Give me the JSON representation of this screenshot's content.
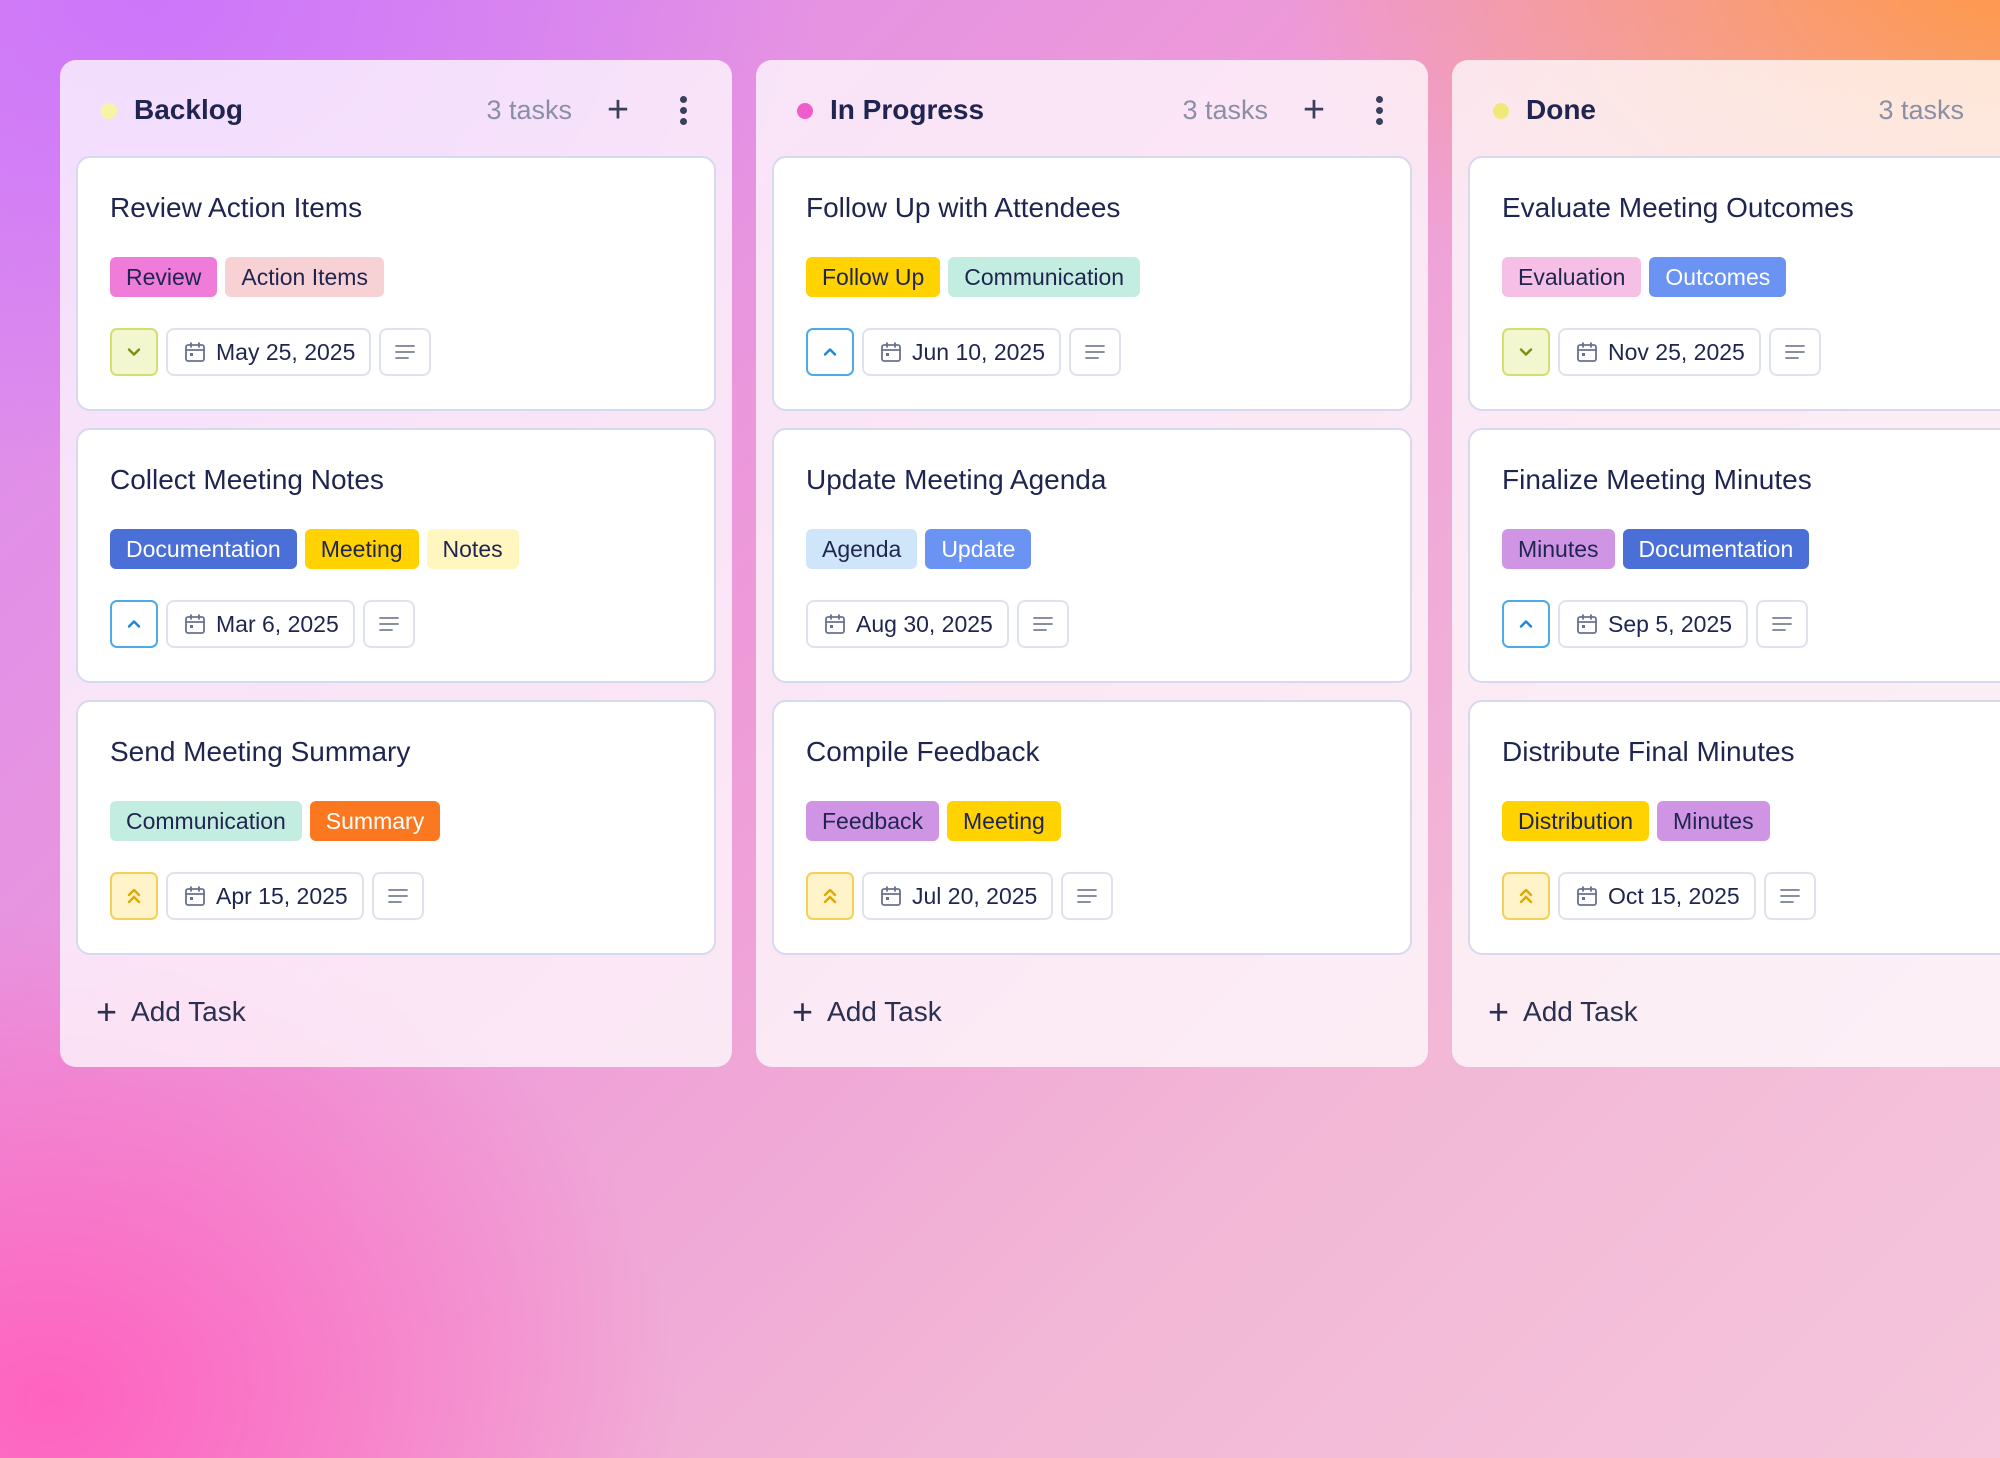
{
  "columns": [
    {
      "title": "Backlog",
      "count": "3 tasks",
      "dot_color": "#f9f3a4",
      "add_task_label": "Add Task",
      "cards": [
        {
          "title": "Review Action Items",
          "tags": [
            {
              "label": "Review",
              "bg": "#f07cd9",
              "fg": "#1f2550"
            },
            {
              "label": "Action Items",
              "bg": "#f7d1d4",
              "fg": "#1f2550"
            }
          ],
          "priority": "low",
          "priority_icon": "chevron-down-icon",
          "date": "May 25, 2025"
        },
        {
          "title": "Collect Meeting Notes",
          "tags": [
            {
              "label": "Documentation",
              "bg": "#4a6fd6",
              "fg": "#ffffff"
            },
            {
              "label": "Meeting",
              "bg": "#ffd200",
              "fg": "#1f2550"
            },
            {
              "label": "Notes",
              "bg": "#fff6c0",
              "fg": "#1f2550"
            }
          ],
          "priority": "medium",
          "priority_icon": "chevron-up-icon",
          "date": "Mar 6, 2025"
        },
        {
          "title": "Send Meeting Summary",
          "tags": [
            {
              "label": "Communication",
              "bg": "#c3ede0",
              "fg": "#1f2550"
            },
            {
              "label": "Summary",
              "bg": "#fb7820",
              "fg": "#ffffff"
            }
          ],
          "priority": "high",
          "priority_icon": "double-chevron-up-icon",
          "date": "Apr 15, 2025"
        }
      ]
    },
    {
      "title": "In Progress",
      "count": "3 tasks",
      "dot_color": "#f05ccb",
      "add_task_label": "Add Task",
      "cards": [
        {
          "title": "Follow Up with Attendees",
          "tags": [
            {
              "label": "Follow Up",
              "bg": "#ffd200",
              "fg": "#1f2550"
            },
            {
              "label": "Communication",
              "bg": "#c3ede0",
              "fg": "#1f2550"
            }
          ],
          "priority": "medium",
          "priority_icon": "chevron-up-icon",
          "date": "Jun 10, 2025"
        },
        {
          "title": "Update Meeting Agenda",
          "tags": [
            {
              "label": "Agenda",
              "bg": "#cfe6fa",
              "fg": "#1f2550"
            },
            {
              "label": "Update",
              "bg": "#6b93f3",
              "fg": "#ffffff"
            }
          ],
          "priority": "none",
          "priority_icon": "",
          "date": "Aug 30, 2025"
        },
        {
          "title": "Compile Feedback",
          "tags": [
            {
              "label": "Feedback",
              "bg": "#cf95e4",
              "fg": "#1f2550"
            },
            {
              "label": "Meeting",
              "bg": "#ffd200",
              "fg": "#1f2550"
            }
          ],
          "priority": "high",
          "priority_icon": "double-chevron-up-icon",
          "date": "Jul 20, 2025"
        }
      ]
    },
    {
      "title": "Done",
      "count": "3 tasks",
      "dot_color": "#f1e87a",
      "add_task_label": "Add Task",
      "cards": [
        {
          "title": "Evaluate Meeting Outcomes",
          "tags": [
            {
              "label": "Evaluation",
              "bg": "#f6c0e6",
              "fg": "#1f2550"
            },
            {
              "label": "Outcomes",
              "bg": "#6b93f3",
              "fg": "#ffffff"
            }
          ],
          "priority": "low",
          "priority_icon": "chevron-down-icon",
          "date": "Nov 25, 2025"
        },
        {
          "title": "Finalize Meeting Minutes",
          "tags": [
            {
              "label": "Minutes",
              "bg": "#cf95e4",
              "fg": "#1f2550"
            },
            {
              "label": "Documentation",
              "bg": "#4a6fd6",
              "fg": "#ffffff"
            }
          ],
          "priority": "medium",
          "priority_icon": "chevron-up-icon",
          "date": "Sep 5, 2025"
        },
        {
          "title": "Distribute Final Minutes",
          "tags": [
            {
              "label": "Distribution",
              "bg": "#ffd200",
              "fg": "#1f2550"
            },
            {
              "label": "Minutes",
              "bg": "#cf95e4",
              "fg": "#1f2550"
            }
          ],
          "priority": "high",
          "priority_icon": "double-chevron-up-icon",
          "date": "Oct 15, 2025"
        }
      ]
    }
  ]
}
